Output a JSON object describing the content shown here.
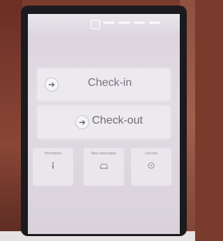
{
  "app": {
    "top_bar": {
      "indicators": [
        "",
        "",
        "",
        ""
      ]
    },
    "logo_text": "",
    "buttons": {
      "checkin_label": "Check-in",
      "checkout_label": "Check-out"
    },
    "cards": [
      {
        "title": "Information",
        "icon": "info-icon",
        "sub": ""
      },
      {
        "title": "New reservation",
        "icon": "car-icon",
        "sub": ""
      },
      {
        "title": "Lost key",
        "icon": "key-icon",
        "sub": ""
      }
    ],
    "footer_text": ""
  },
  "colors": {
    "screen_bg": "#dcd3dc",
    "button_bg": "#eceaef",
    "button_text": "#77737d"
  }
}
